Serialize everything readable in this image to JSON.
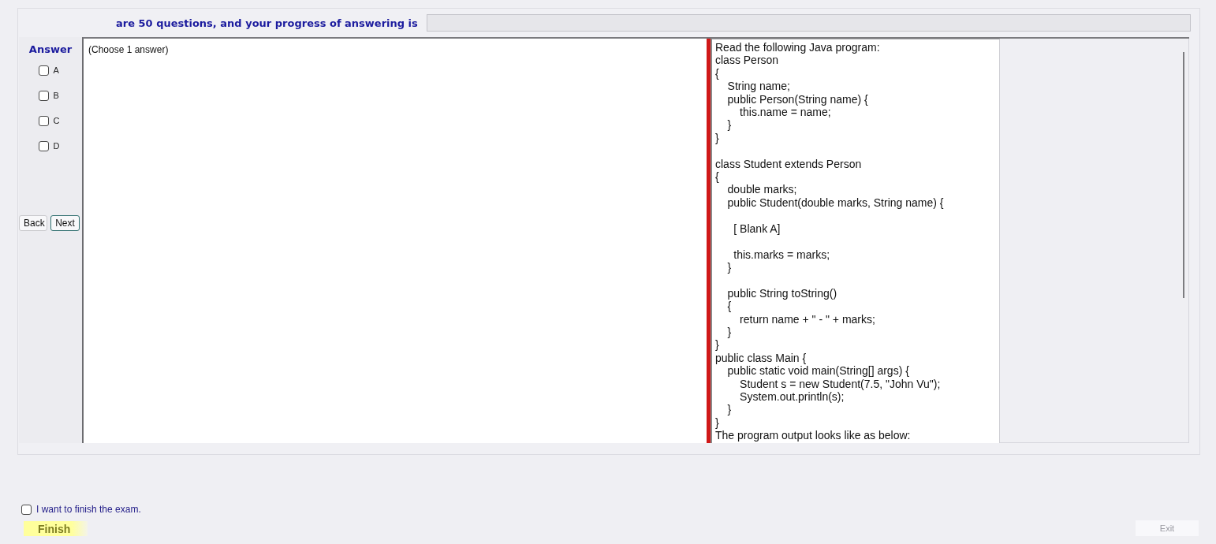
{
  "header": {
    "progress_label": "are 50 questions, and your progress of answering is",
    "progress": {
      "level": 0
    }
  },
  "answer_panel": {
    "title": "Answer",
    "options": [
      {
        "label": "A",
        "checked": false
      },
      {
        "label": "B",
        "checked": false
      },
      {
        "label": "C",
        "checked": false
      },
      {
        "label": "D",
        "checked": false
      }
    ]
  },
  "navigation": [
    {
      "label": "Back",
      "focused": false
    },
    {
      "label": "Next",
      "focused": true
    }
  ],
  "question": {
    "instruction": "(Choose 1 answer)",
    "text": "Read the following Java program:\nclass Person\n{\n    String name;\n    public Person(String name) {\n        this.name = name;\n    }\n}\n\nclass Student extends Person\n{\n    double marks;\n    public Student(double marks, String name) {\n\n      [ Blank A]\n\n      this.marks = marks;\n    }\n\n    public String toString()\n    {\n        return name + \" - \" + marks;\n    }\n}\npublic class Main {\n    public static void main(String[] args) {\n        Student s = new Student(7.5, \"John Vu\");\n        System.out.println(s);\n    }\n}\nThe program output looks like as below:"
  },
  "footer": {
    "confirm": {
      "label": "I want to finish the exam.",
      "checked": false
    },
    "finish_button": {
      "label": "Finish"
    },
    "exit_button": {
      "label": "Exit",
      "disabled": true
    }
  }
}
